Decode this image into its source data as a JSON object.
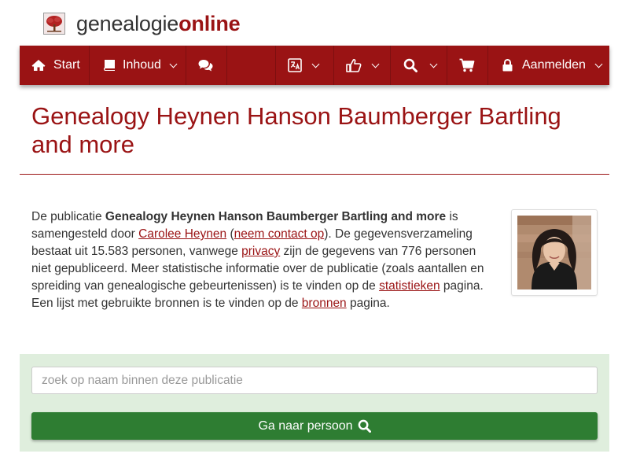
{
  "header": {
    "logo_part1": "genealogie",
    "logo_part2": "online"
  },
  "nav": {
    "start_label": "Start",
    "inhoud_label": "Inhoud",
    "login_label": "Aanmelden",
    "icons": [
      "home-icon",
      "book-icon",
      "comments-icon",
      "translate-icon",
      "thumbs-up-icon",
      "search-icon",
      "cart-icon",
      "lock-icon"
    ]
  },
  "page": {
    "title": "Genealogy Heynen Hanson Baumberger Bartling and more"
  },
  "intro": {
    "t1": "De publicatie ",
    "pub_name": "Genealogy Heynen Hanson Baumberger Bartling and more",
    "t2": " is samengesteld door ",
    "author": "Carolee Heynen",
    "t3": " (",
    "contact": "neem contact op",
    "t4": "). De gegevensverzameling bestaat uit 15.583 personen, vanwege ",
    "privacy": "privacy",
    "t5": " zijn de gegevens van 776 personen niet gepubliceerd. Meer statistische informatie over de publicatie (zoals aantallen en spreiding van genealogische gebeurtenissen) is te vinden op de ",
    "stats": "statistieken",
    "t6": " pagina. Een lijst met gebruikte bronnen is te vinden op de ",
    "sources": "bronnen",
    "t7": " pagina."
  },
  "search": {
    "placeholder": "zoek op naam binnen deze publicatie",
    "button_label": "Ga naar persoon"
  },
  "colors": {
    "brand": "#9a1314",
    "panel": "#dfeedd",
    "button": "#2e7d32"
  }
}
